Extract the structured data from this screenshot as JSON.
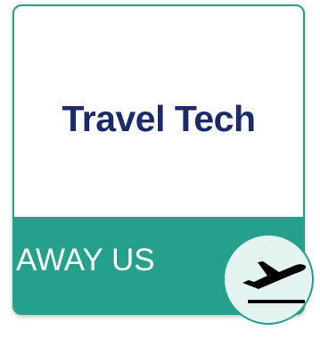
{
  "card": {
    "title": "Travel Tech",
    "label": "AWAY US",
    "icon": "airplane-takeoff-icon"
  },
  "colors": {
    "accent": "#25a08c",
    "title": "#1a2a6a",
    "badge_bg": "#e4f4f1"
  }
}
